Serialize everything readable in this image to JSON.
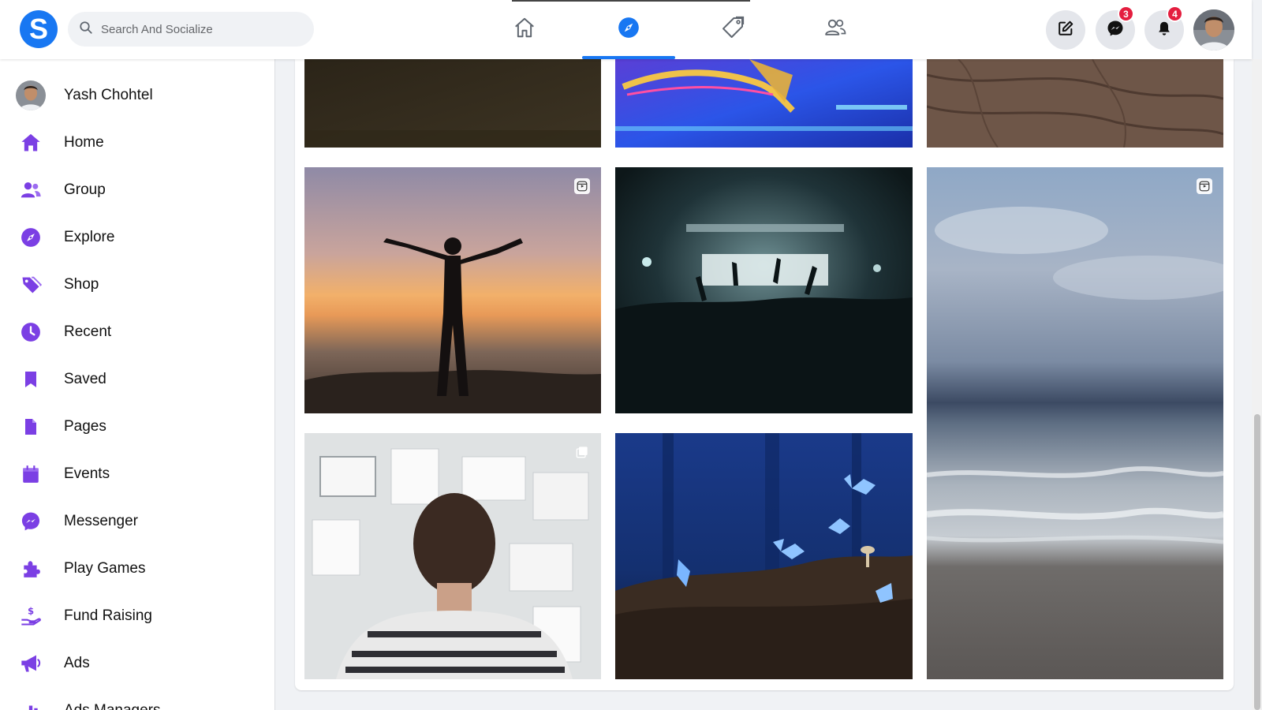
{
  "header": {
    "logo_letter": "S",
    "search_placeholder": "Search And Socialize",
    "nav_tabs": [
      {
        "name": "home",
        "icon": "home-icon",
        "active": false
      },
      {
        "name": "explore",
        "icon": "compass-icon",
        "active": true
      },
      {
        "name": "shop",
        "icon": "tag-icon",
        "active": false
      },
      {
        "name": "friends",
        "icon": "friends-icon",
        "active": false
      }
    ],
    "messenger_badge": "3",
    "notifications_badge": "4"
  },
  "sidebar": {
    "profile_name": "Yash Chohtel",
    "items": [
      {
        "label": "Home",
        "icon": "home-icon"
      },
      {
        "label": "Group",
        "icon": "group-icon"
      },
      {
        "label": "Explore",
        "icon": "compass-icon"
      },
      {
        "label": "Shop",
        "icon": "tag-icon"
      },
      {
        "label": "Recent",
        "icon": "clock-icon"
      },
      {
        "label": "Saved",
        "icon": "bookmark-icon"
      },
      {
        "label": "Pages",
        "icon": "page-icon"
      },
      {
        "label": "Events",
        "icon": "calendar-icon"
      },
      {
        "label": "Messenger",
        "icon": "messenger-icon"
      },
      {
        "label": "Play Games",
        "icon": "puzzle-icon"
      },
      {
        "label": "Fund Raising",
        "icon": "fundraise-icon"
      },
      {
        "label": "Ads",
        "icon": "megaphone-icon"
      },
      {
        "label": "Ads Managers",
        "icon": "chart-icon"
      }
    ]
  },
  "colors": {
    "accent": "#1877f2",
    "sidebar_icon": "#7b3fe4",
    "badge": "#e41e3f"
  },
  "feed": {
    "tiles": [
      {
        "name": "tile-dark-texture",
        "kind": "photo",
        "reel": false
      },
      {
        "name": "tile-dancer",
        "kind": "photo",
        "reel": false
      },
      {
        "name": "tile-skin-texture",
        "kind": "photo",
        "reel": false
      },
      {
        "name": "tile-sunset-man",
        "kind": "reel",
        "reel": true
      },
      {
        "name": "tile-concert",
        "kind": "photo",
        "reel": false
      },
      {
        "name": "tile-ocean",
        "kind": "reel",
        "reel": true
      },
      {
        "name": "tile-man-board",
        "kind": "album",
        "reel": false
      },
      {
        "name": "tile-butterflies",
        "kind": "photo",
        "reel": false
      }
    ]
  }
}
